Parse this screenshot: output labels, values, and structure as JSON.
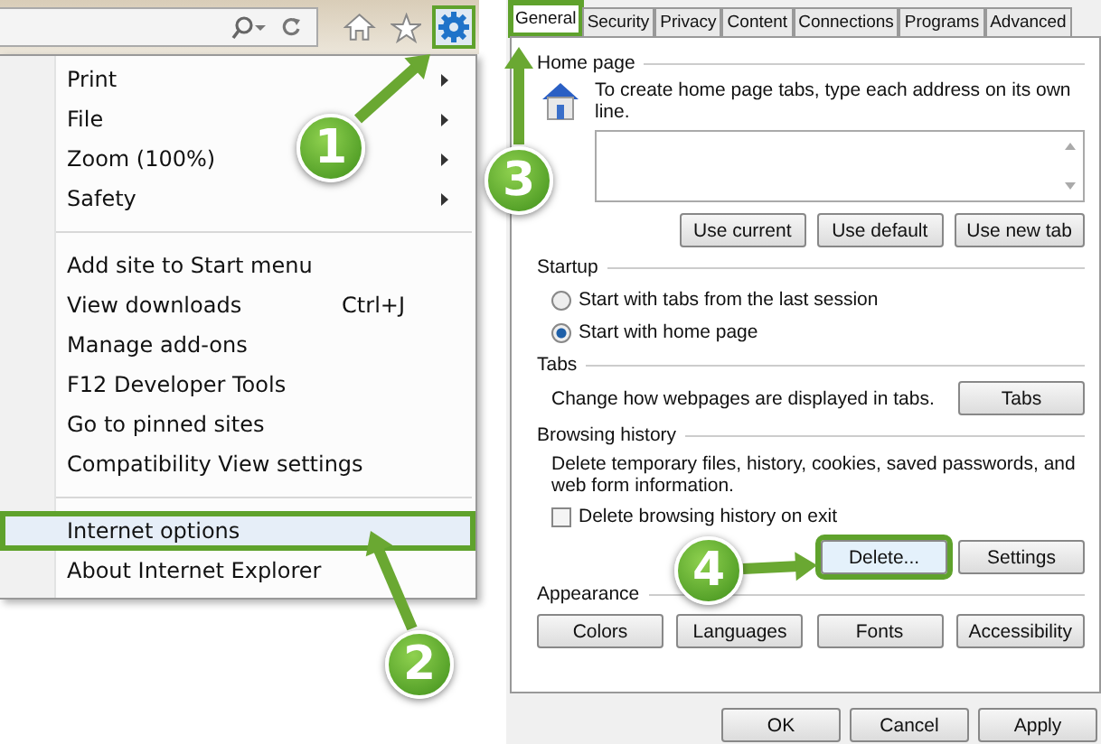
{
  "toolbar": {
    "settings_highlighted": true
  },
  "menu": {
    "groups": [
      [
        {
          "label": "Print",
          "submenu": true,
          "highlighted": false
        },
        {
          "label": "File",
          "submenu": true,
          "highlighted": false
        },
        {
          "label": "Zoom (100%)",
          "submenu": true,
          "highlighted": false
        },
        {
          "label": "Safety",
          "submenu": true,
          "highlighted": false
        }
      ],
      [
        {
          "label": "Add site to Start menu",
          "submenu": false,
          "highlighted": false
        },
        {
          "label": "View downloads",
          "shortcut": "Ctrl+J",
          "submenu": false,
          "highlighted": false
        },
        {
          "label": "Manage add-ons",
          "submenu": false,
          "highlighted": false
        },
        {
          "label": "F12 Developer Tools",
          "submenu": false,
          "highlighted": false
        },
        {
          "label": "Go to pinned sites",
          "submenu": false,
          "highlighted": false
        },
        {
          "label": "Compatibility View settings",
          "submenu": false,
          "highlighted": false
        }
      ],
      [
        {
          "label": "Internet options",
          "submenu": false,
          "highlighted": true
        },
        {
          "label": "About Internet Explorer",
          "submenu": false,
          "highlighted": false
        }
      ]
    ]
  },
  "dialog": {
    "tabs": [
      {
        "label": "General",
        "selected": true,
        "highlighted": true
      },
      {
        "label": "Security",
        "selected": false,
        "highlighted": false
      },
      {
        "label": "Privacy",
        "selected": false,
        "highlighted": false
      },
      {
        "label": "Content",
        "selected": false,
        "highlighted": false
      },
      {
        "label": "Connections",
        "selected": false,
        "highlighted": false
      },
      {
        "label": "Programs",
        "selected": false,
        "highlighted": false
      },
      {
        "label": "Advanced",
        "selected": false,
        "highlighted": false
      }
    ],
    "home_page": {
      "title": "Home page",
      "description": "To create home page tabs, type each address on its own line.",
      "buttons": [
        "Use current",
        "Use default",
        "Use new tab"
      ]
    },
    "startup": {
      "title": "Startup",
      "options": [
        {
          "label": "Start with tabs from the last session",
          "selected": false
        },
        {
          "label": "Start with home page",
          "selected": true
        }
      ]
    },
    "tabs_section": {
      "title": "Tabs",
      "description": "Change how webpages are displayed in tabs.",
      "button": "Tabs"
    },
    "browsing_history": {
      "title": "Browsing history",
      "description": "Delete temporary files, history, cookies, saved passwords, and web form information.",
      "checkbox": {
        "label": "Delete browsing history on exit",
        "checked": false
      },
      "buttons": [
        {
          "label": "Delete...",
          "highlighted": true
        },
        {
          "label": "Settings",
          "highlighted": false
        }
      ]
    },
    "appearance": {
      "title": "Appearance",
      "buttons": [
        "Colors",
        "Languages",
        "Fonts",
        "Accessibility"
      ]
    },
    "footer_buttons": [
      "OK",
      "Cancel",
      "Apply"
    ]
  },
  "callouts": [
    {
      "number": "1"
    },
    {
      "number": "2"
    },
    {
      "number": "3"
    },
    {
      "number": "4"
    }
  ]
}
